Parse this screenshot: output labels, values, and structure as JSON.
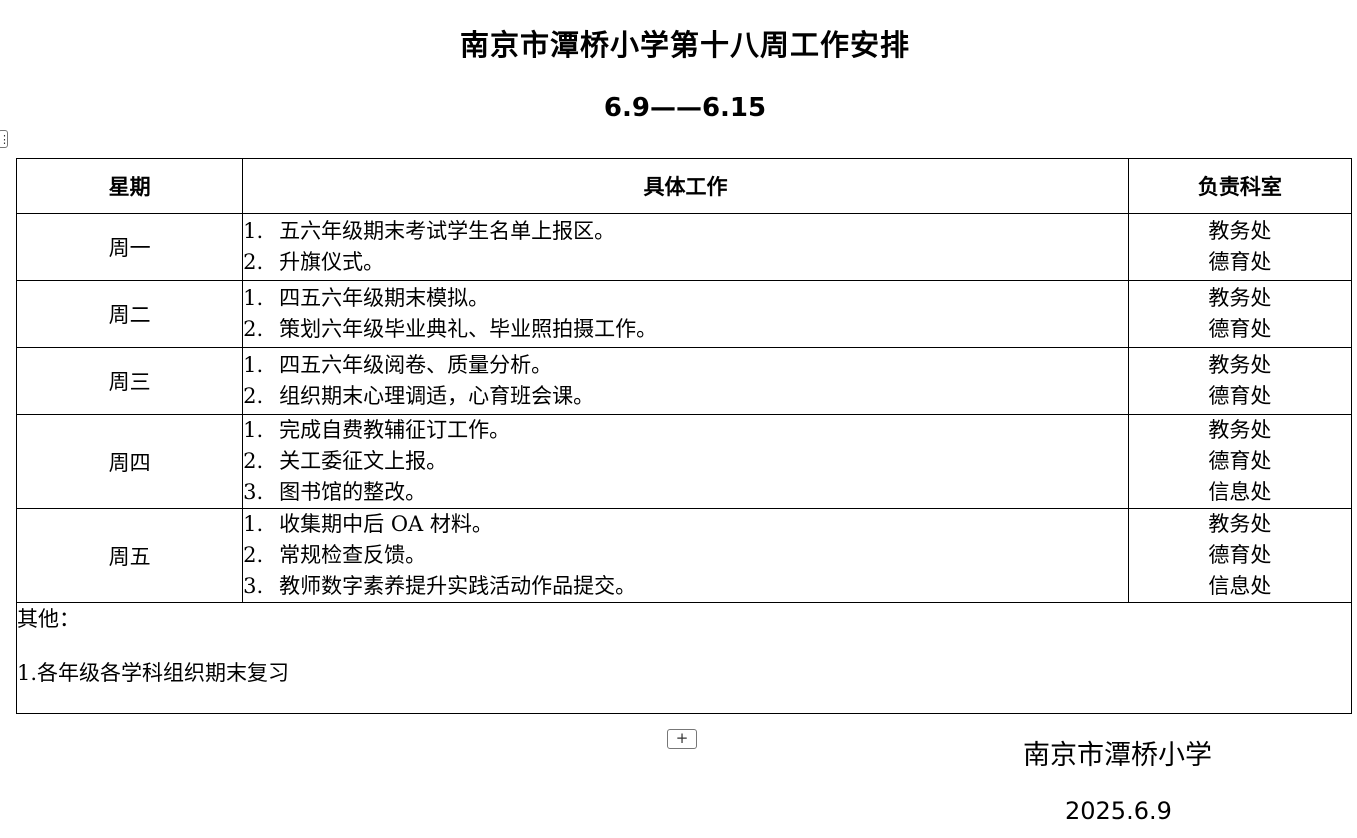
{
  "document": {
    "title": "南京市潭桥小学第十八周工作安排",
    "date_range": "6.9——6.15"
  },
  "table": {
    "headers": {
      "day": "星期",
      "work": "具体工作",
      "dept": "负责科室"
    },
    "rows": [
      {
        "day": "周一",
        "items": [
          {
            "num": "1.",
            "text": "五六年级期末考试学生名单上报区。",
            "dept": "教务处"
          },
          {
            "num": "2.",
            "text": "升旗仪式。",
            "dept": "德育处"
          }
        ]
      },
      {
        "day": "周二",
        "items": [
          {
            "num": "1.",
            "text": "四五六年级期末模拟。",
            "dept": "教务处"
          },
          {
            "num": "2.",
            "text": "策划六年级毕业典礼、毕业照拍摄工作。",
            "dept": "德育处"
          }
        ]
      },
      {
        "day": "周三",
        "items": [
          {
            "num": "1.",
            "text": "四五六年级阅卷、质量分析。",
            "dept": "教务处"
          },
          {
            "num": "2.",
            "text": "组织期末心理调适，心育班会课。",
            "dept": "德育处"
          }
        ]
      },
      {
        "day": "周四",
        "items": [
          {
            "num": "1.",
            "text": "完成自费教辅征订工作。",
            "dept": "教务处"
          },
          {
            "num": "2.",
            "text": "关工委征文上报。",
            "dept": "德育处"
          },
          {
            "num": "3.",
            "text": "图书馆的整改。",
            "dept": "信息处"
          }
        ]
      },
      {
        "day": "周五",
        "items": [
          {
            "num": "1.",
            "text": "收集期中后 OA 材料。",
            "dept": "教务处"
          },
          {
            "num": "2.",
            "text": "常规检查反馈。",
            "dept": "德育处"
          },
          {
            "num": "3.",
            "text": "教师数字素养提升实践活动作品提交。",
            "dept": "信息处"
          }
        ]
      }
    ],
    "other": {
      "heading": "其他：",
      "item": "1.各年级各学科组织期末复习"
    }
  },
  "controls": {
    "add_row_label": "+",
    "table_handle_label": "⋮"
  },
  "signature": {
    "school": "南京市潭桥小学",
    "date": "2025.6.9"
  }
}
